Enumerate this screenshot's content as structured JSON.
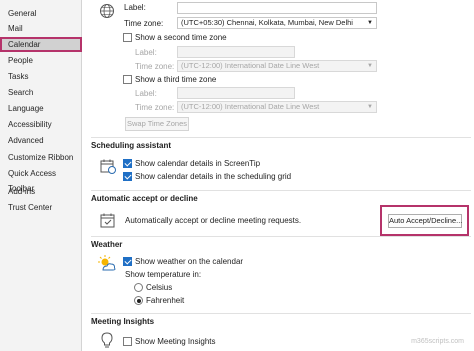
{
  "sidebar": {
    "items": [
      {
        "label": "General"
      },
      {
        "label": "Mail"
      },
      {
        "label": "Calendar"
      },
      {
        "label": "People"
      },
      {
        "label": "Tasks"
      },
      {
        "label": "Search"
      },
      {
        "label": "Language"
      },
      {
        "label": "Accessibility"
      },
      {
        "label": "Advanced"
      },
      {
        "label": "Customize Ribbon"
      },
      {
        "label": "Quick Access Toolbar"
      },
      {
        "label": "Add-ins"
      },
      {
        "label": "Trust Center"
      }
    ],
    "selected": "Calendar"
  },
  "time_zones": {
    "label_caption": "Label:",
    "label_value": "",
    "time_zone_caption": "Time zone:",
    "time_zone_value": "(UTC+05:30) Chennai, Kolkata, Mumbai, New Delhi",
    "second_checkbox": "Show a second time zone",
    "second_label_caption": "Label:",
    "second_time_zone_caption": "Time zone:",
    "second_time_zone_value": "(UTC-12:00) International Date Line West",
    "third_checkbox": "Show a third time zone",
    "third_label_caption": "Label:",
    "third_time_zone_caption": "Time zone:",
    "third_time_zone_value": "(UTC-12:00) International Date Line West",
    "swap_button": "Swap Time Zones"
  },
  "scheduling": {
    "title": "Scheduling assistant",
    "screentip": "Show calendar details in ScreenTip",
    "grid": "Show calendar details in the scheduling grid"
  },
  "auto_accept": {
    "title": "Automatic accept or decline",
    "description": "Automatically accept or decline meeting requests.",
    "button": "Auto Accept/Decline..."
  },
  "weather": {
    "title": "Weather",
    "show": "Show weather on the calendar",
    "temp_caption": "Show temperature in:",
    "celsius": "Celsius",
    "fahrenheit": "Fahrenheit"
  },
  "insights": {
    "title": "Meeting Insights",
    "show": "Show Meeting Insights"
  },
  "watermark": "m365scripts.com",
  "colors": {
    "accent": "#1f6fc5",
    "highlight": "#b5336a"
  }
}
